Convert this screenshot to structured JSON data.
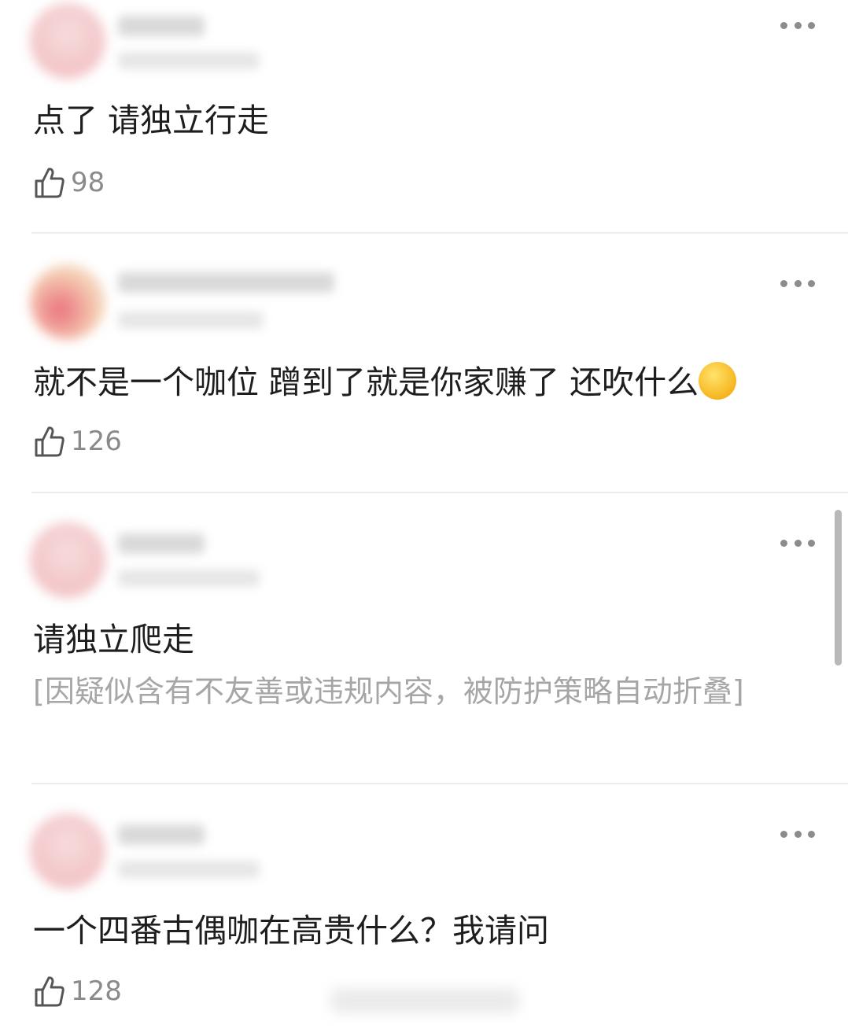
{
  "comments": [
    {
      "text": "点了 请独立行走",
      "likes": "98"
    },
    {
      "text": "就不是一个咖位 蹭到了就是你家赚了 还吹什么",
      "emoji": "rolling-on-floor-laughing-emoji",
      "likes": "126"
    },
    {
      "text": "请独立爬走",
      "folded_notice": "[因疑似含有不友善或违规内容，被防护策略自动折叠]"
    },
    {
      "text": "一个四番古偶咖在高贵什么？我请问",
      "likes": "128"
    }
  ],
  "icons": {
    "like": "thumbs-up-icon",
    "more": "more-dots-icon"
  },
  "colors": {
    "text": "#1e1e1e",
    "muted": "#8a8a8a",
    "folded": "#a6a6a6",
    "divider": "#ececec"
  }
}
